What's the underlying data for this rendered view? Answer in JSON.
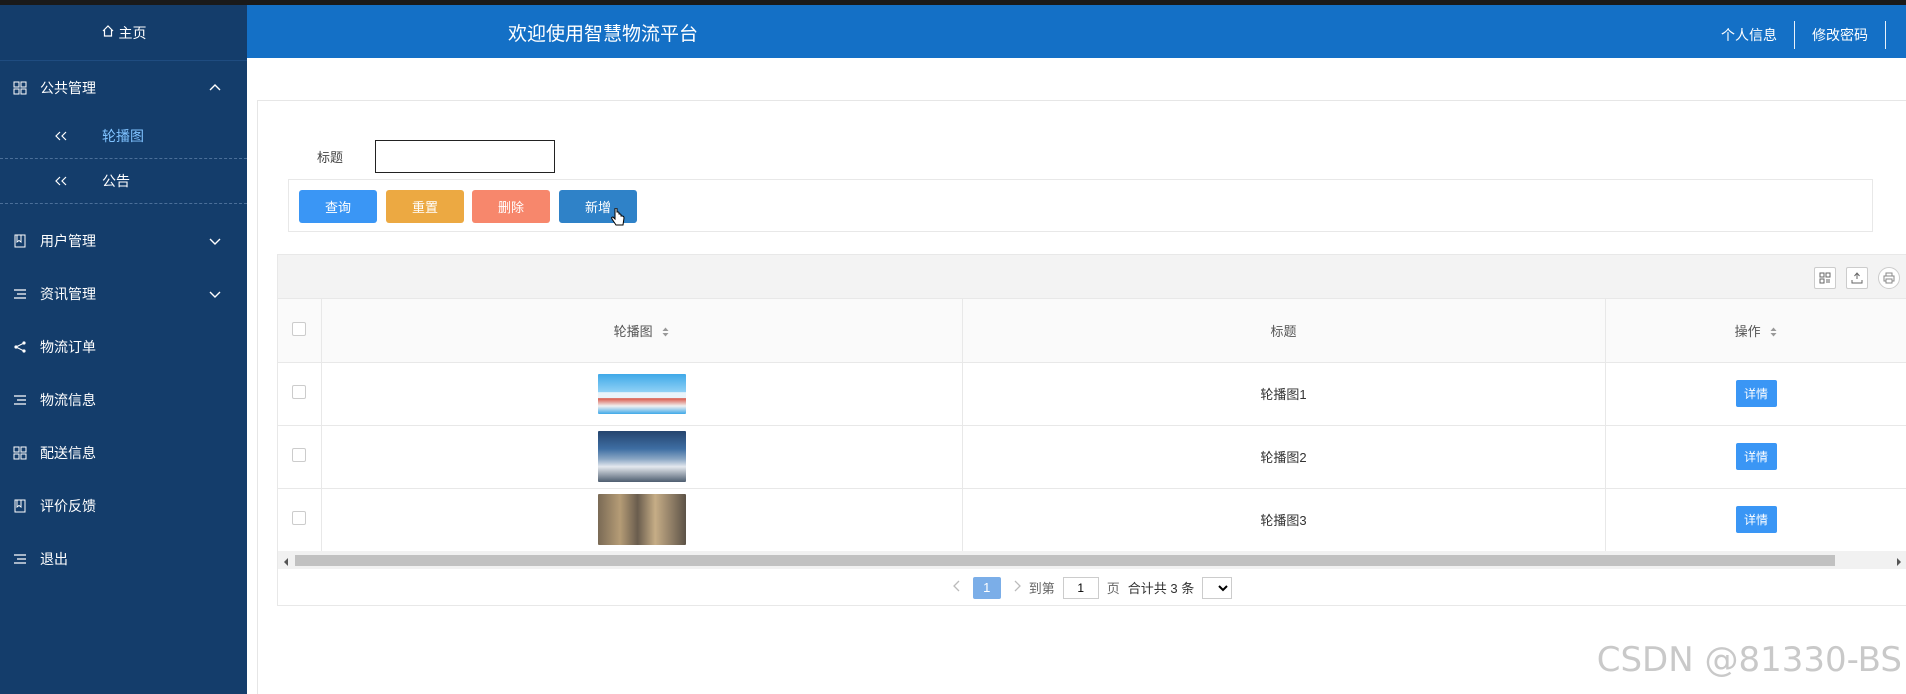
{
  "sidebar": {
    "home_label": "主页",
    "items": [
      {
        "label": "公共管理",
        "icon": "grid-icon",
        "expanded": true,
        "children": [
          {
            "label": "轮播图",
            "active": true
          },
          {
            "label": "公告",
            "active": false
          }
        ]
      },
      {
        "label": "用户管理",
        "icon": "book-icon",
        "expanded": false
      },
      {
        "label": "资讯管理",
        "icon": "list-icon",
        "expanded": false
      },
      {
        "label": "物流订单",
        "icon": "share-icon"
      },
      {
        "label": "物流信息",
        "icon": "list-icon"
      },
      {
        "label": "配送信息",
        "icon": "grid-icon"
      },
      {
        "label": "评价反馈",
        "icon": "book-icon"
      },
      {
        "label": "退出",
        "icon": "list-icon"
      }
    ]
  },
  "header": {
    "title": "欢迎使用智慧物流平台",
    "links": [
      "个人信息",
      "修改密码"
    ]
  },
  "search": {
    "title_label": "标题",
    "title_value": ""
  },
  "buttons": {
    "query": "查询",
    "reset": "重置",
    "delete": "删除",
    "add": "新增"
  },
  "table": {
    "columns": [
      "轮播图",
      "标题",
      "操作"
    ],
    "rows": [
      {
        "title": "轮播图1",
        "action": "详情"
      },
      {
        "title": "轮播图2",
        "action": "详情"
      },
      {
        "title": "轮播图3",
        "action": "详情"
      }
    ]
  },
  "pager": {
    "current_page": "1",
    "goto_label": "到第",
    "goto_value": "1",
    "page_suffix": "页",
    "total_text": "合计共 3 条"
  },
  "watermark": "CSDN @81330-BS",
  "colors": {
    "sidebar_bg": "#143d6b",
    "header_bg": "#1470c6",
    "query_btn": "#3a96f5",
    "reset_btn": "#eca942",
    "delete_btn": "#f7876c",
    "add_btn": "#2f82c8"
  }
}
